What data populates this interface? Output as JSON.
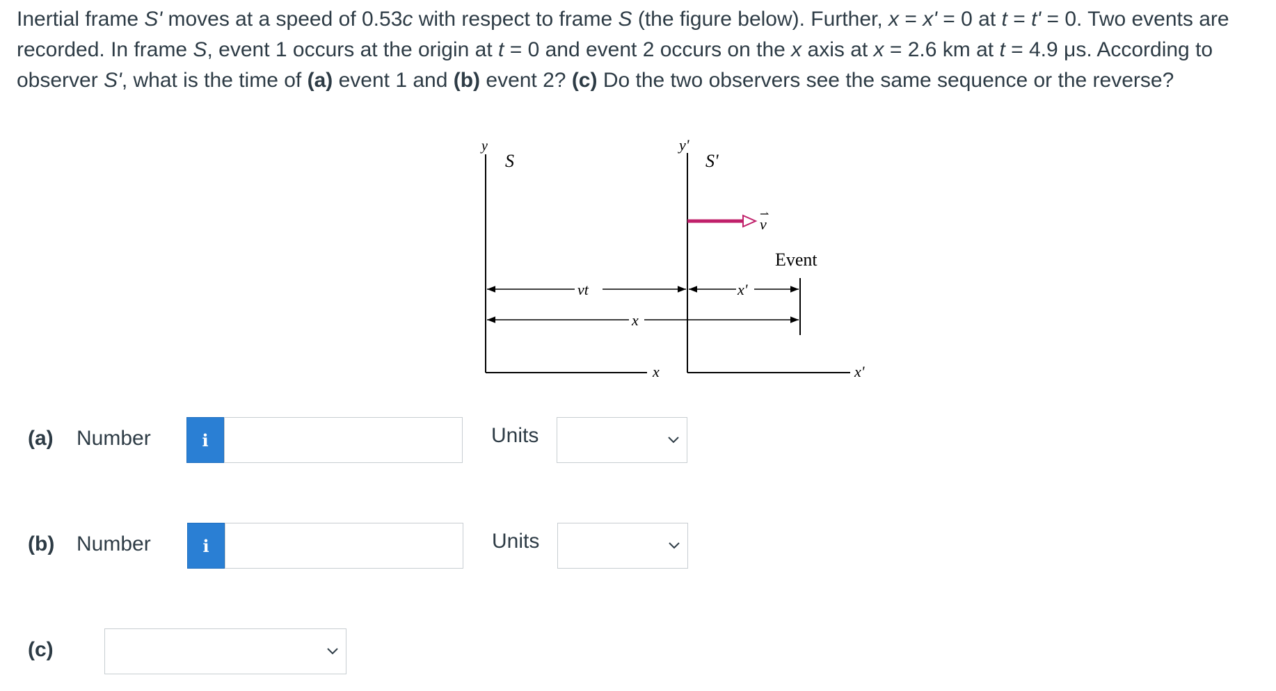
{
  "question": {
    "p1": "Inertial frame ",
    "s_prime_1": "S'",
    "p2": " moves at a speed of 0.53",
    "c1": "c",
    "p3": " with respect to frame ",
    "s1": "S",
    "p4": " (the figure below). Further, ",
    "x_eq": "x",
    "p5": " = ",
    "xp_eq": "x'",
    "p6": " = 0 at ",
    "t_eq": "t",
    "p7": " = ",
    "tp_eq": "t'",
    "p8": " = 0. Two events are recorded. In frame ",
    "s2": "S",
    "p9": ", event 1 occurs at the origin at ",
    "t2": "t",
    "p10": " = 0 and event 2 occurs on the ",
    "x2": "x",
    "p11": " axis at ",
    "x3": "x",
    "p12": " = 2.6 km at ",
    "t3": "t",
    "p13": " = 4.9 μs. According to observer ",
    "s_prime_2": "S'",
    "p14": ", what is the time of ",
    "a": "(a)",
    "p15": " event 1 and ",
    "b": "(b)",
    "p16": " event 2? ",
    "c": "(c)",
    "p17": " Do the two observers see the same sequence or the reverse?"
  },
  "figure": {
    "y_label": "y",
    "s_label": "S",
    "yp_label": "y'",
    "sp_label": "S'",
    "v_label": "v",
    "event_label": "Event",
    "vt_label": "vt",
    "xp_dim_label": "x'",
    "x_dim_label": "x",
    "x_axis_label": "x",
    "xp_axis_label": "x'",
    "velocity_color": "#c0206a"
  },
  "parts": [
    {
      "label": "(a)",
      "number_label": "Number",
      "info": "i",
      "value": "",
      "units_label": "Units",
      "units_value": ""
    },
    {
      "label": "(b)",
      "number_label": "Number",
      "info": "i",
      "value": "",
      "units_label": "Units",
      "units_value": ""
    }
  ],
  "part_c": {
    "label": "(c)",
    "value": ""
  }
}
